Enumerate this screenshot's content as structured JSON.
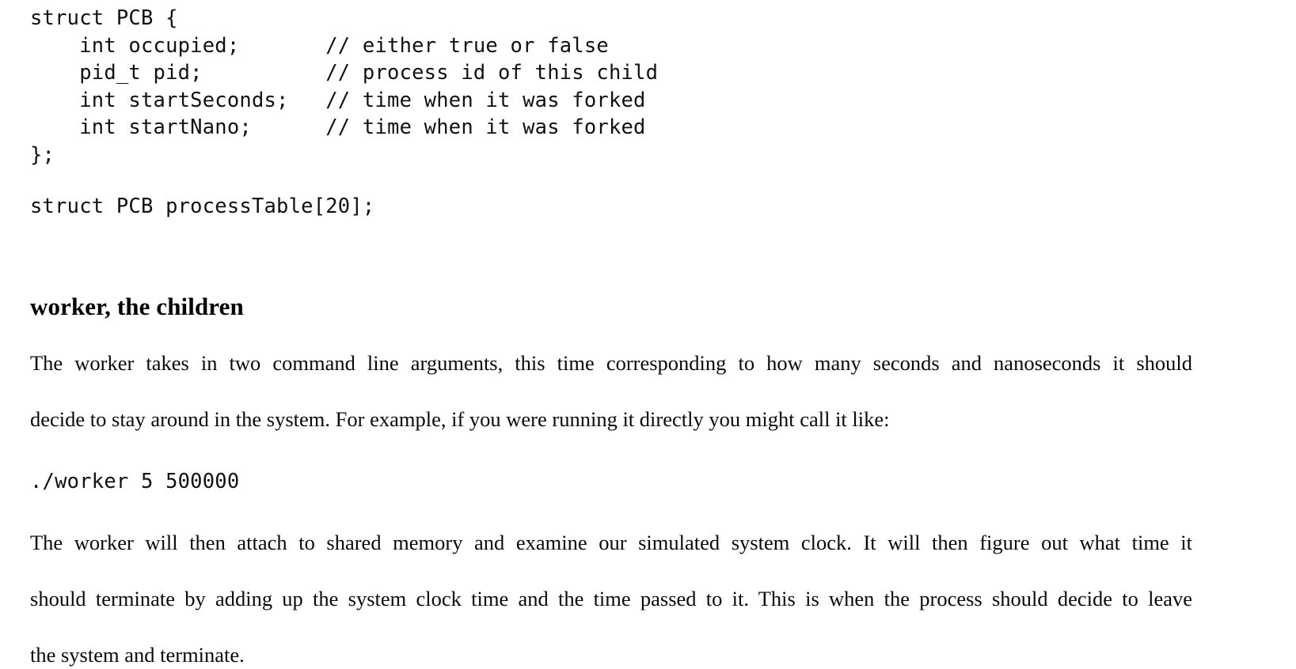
{
  "document": {
    "code_struct": {
      "lines": [
        "struct PCB {",
        "    int occupied;       // either true or false",
        "    pid_t pid;          // process id of this child",
        "    int startSeconds;   // time when it was forked",
        "    int startNano;      // time when it was forked",
        "};"
      ]
    },
    "code_table": {
      "lines": [
        "struct PCB processTable[20];"
      ]
    },
    "heading": "worker, the children",
    "paragraph_intro_line1": "The worker takes in two command line arguments, this time corresponding to how many seconds and nanoseconds it should",
    "paragraph_intro_line2": "decide to stay around in the system. For example, if you were running it directly you might call it like:",
    "command_example": "./worker 5 500000",
    "paragraph_outro_line1": "The worker will then attach to shared memory and examine our simulated system clock.  It will then figure out what time it",
    "paragraph_outro_line2": "should terminate by adding up the system clock time and the time passed to it. This is when the process should decide to leave",
    "paragraph_outro_line3": "the system and terminate."
  },
  "colors": {
    "page_background": "#ffffff",
    "body_text": "#0a0a0a",
    "code_text": "#111111"
  }
}
